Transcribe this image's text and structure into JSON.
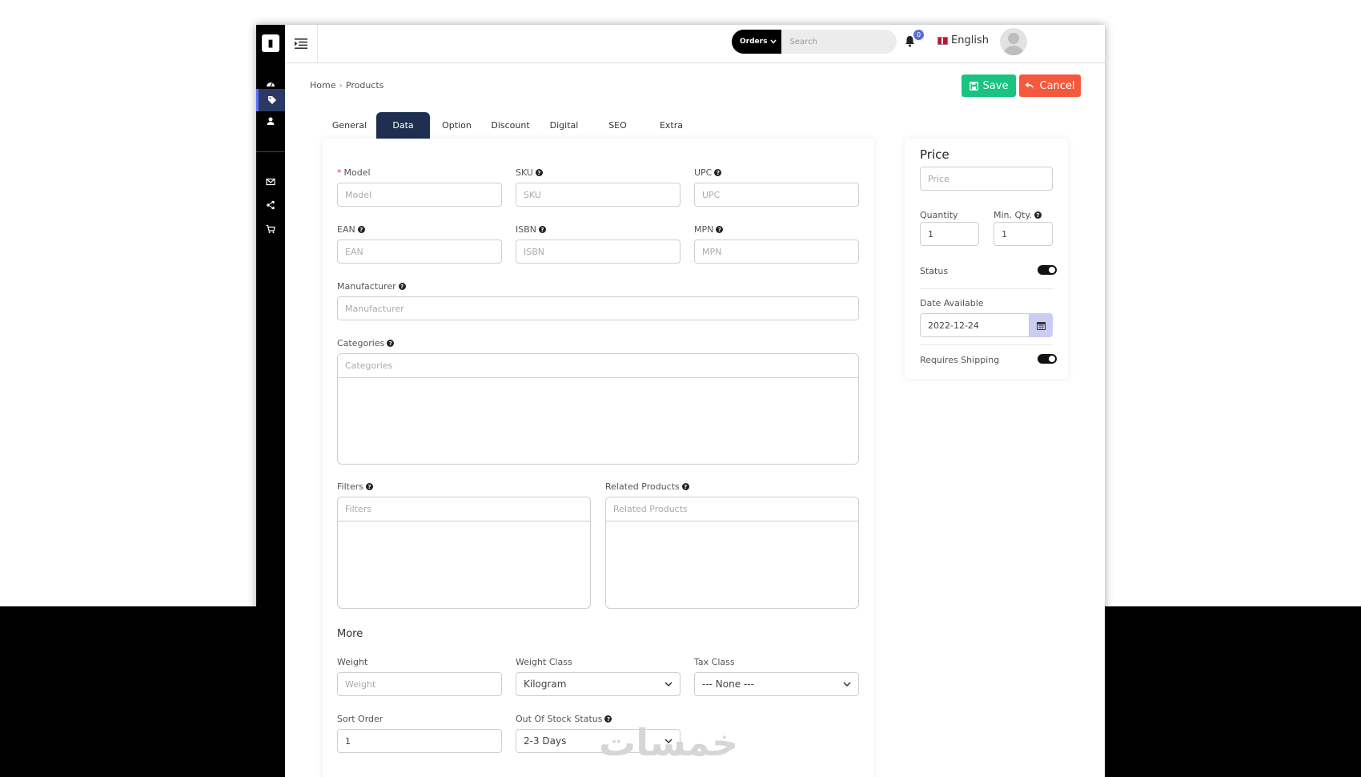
{
  "topbar": {
    "search_scope": "Orders",
    "search_placeholder": "Search",
    "notification_count": "0",
    "language": "English"
  },
  "breadcrumb": {
    "home": "Home",
    "separator": "›",
    "current": "Products"
  },
  "actions": {
    "save_label": "Save",
    "cancel_label": "Cancel"
  },
  "tabs": [
    {
      "label": "General"
    },
    {
      "label": "Data"
    },
    {
      "label": "Option"
    },
    {
      "label": "Discount"
    },
    {
      "label": "Digital"
    },
    {
      "label": "SEO"
    },
    {
      "label": "Extra"
    }
  ],
  "active_tab": "Data",
  "form": {
    "model": {
      "label": "Model",
      "placeholder": "Model"
    },
    "sku": {
      "label": "SKU",
      "placeholder": "SKU"
    },
    "upc": {
      "label": "UPC",
      "placeholder": "UPC"
    },
    "ean": {
      "label": "EAN",
      "placeholder": "EAN"
    },
    "isbn": {
      "label": "ISBN",
      "placeholder": "ISBN"
    },
    "mpn": {
      "label": "MPN",
      "placeholder": "MPN"
    },
    "manufacturer": {
      "label": "Manufacturer",
      "placeholder": "Manufacturer"
    },
    "categories": {
      "label": "Categories",
      "placeholder": "Categories"
    },
    "filters": {
      "label": "Filters",
      "placeholder": "Filters"
    },
    "related": {
      "label": "Related Products",
      "placeholder": "Related Products"
    },
    "more_title": "More",
    "weight": {
      "label": "Weight",
      "placeholder": "Weight"
    },
    "weight_class": {
      "label": "Weight Class",
      "value": "Kilogram"
    },
    "tax_class": {
      "label": "Tax Class",
      "value": "--- None ---"
    },
    "sort_order": {
      "label": "Sort Order",
      "value": "1"
    },
    "stock_status": {
      "label": "Out Of Stock Status",
      "value": "2-3 Days"
    }
  },
  "side": {
    "title": "Price",
    "price_placeholder": "Price",
    "quantity": {
      "label": "Quantity",
      "value": "1"
    },
    "min_qty": {
      "label": "Min. Qty.",
      "value": "1"
    },
    "status_label": "Status",
    "status_on": true,
    "date_label": "Date Available",
    "date_value": "2022-12-24",
    "shipping_label": "Requires Shipping",
    "shipping_on": true
  },
  "colors": {
    "save": "#18c47f",
    "cancel": "#f4593c",
    "active_tab": "#1f2f51",
    "sidebar": "#000000",
    "badge": "#5a6dd6"
  },
  "watermark": "خمسات"
}
